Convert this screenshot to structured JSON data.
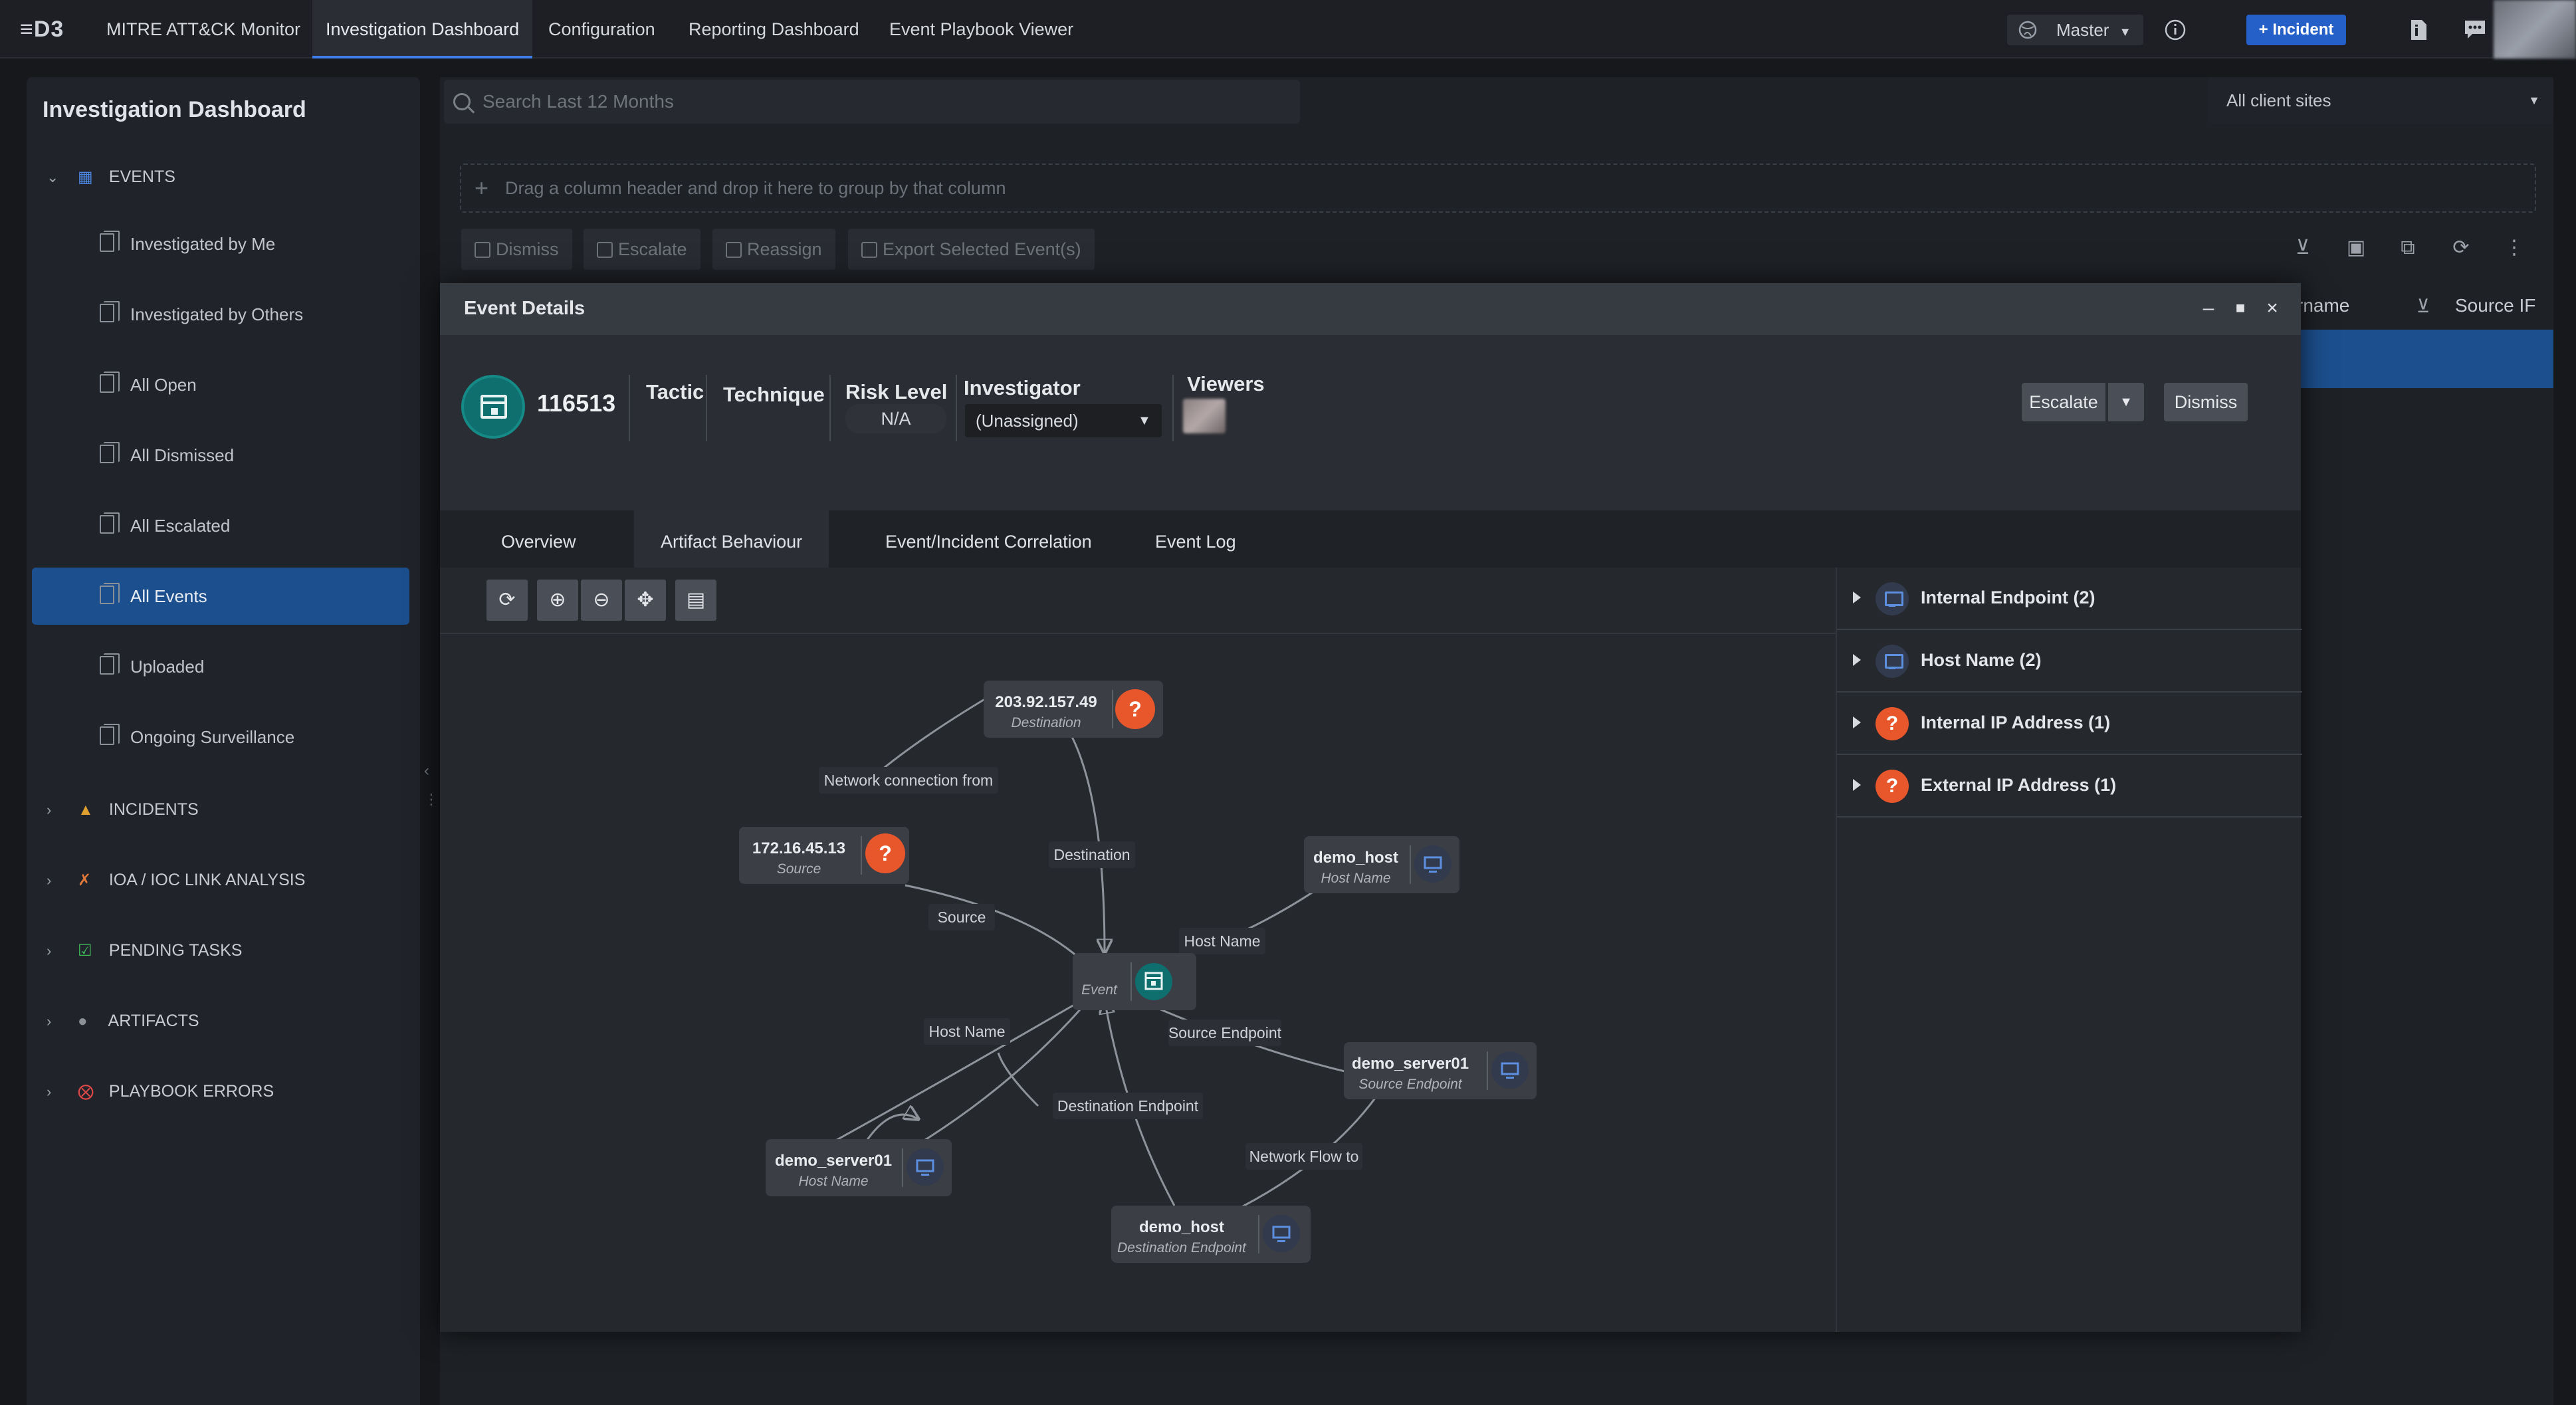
{
  "app": {
    "logo": "≡D3",
    "nav": [
      "MITRE ATT&CK Monitor",
      "Investigation Dashboard",
      "Configuration",
      "Reporting Dashboard",
      "Event Playbook Viewer"
    ],
    "master_label": "Master",
    "incident_label": "+ Incident"
  },
  "sidebar": {
    "title": "Investigation Dashboard",
    "events_group": "EVENTS",
    "items": [
      "Investigated by Me",
      "Investigated by Others",
      "All Open",
      "All Dismissed",
      "All Escalated",
      "All Events",
      "Uploaded",
      "Ongoing Surveillance"
    ],
    "groups": [
      "INCIDENTS",
      "IOA / IOC LINK ANALYSIS",
      "PENDING TASKS",
      "ARTIFACTS",
      "PLAYBOOK ERRORS"
    ]
  },
  "main": {
    "search_placeholder": "Search Last 12 Months",
    "sites": "All client sites",
    "drop_hint": "Drag a column header and drop it here to group by that column",
    "toolbar": [
      "Dismiss",
      "Escalate",
      "Reassign",
      "Export Selected Event(s)"
    ],
    "columns": [
      "rname",
      "Source IF"
    ]
  },
  "modal": {
    "title": "Event Details",
    "event_id": "116513",
    "labels": {
      "tactic": "Tactic",
      "technique": "Technique",
      "risk": "Risk Level",
      "investigator": "Investigator",
      "viewers": "Viewers"
    },
    "risk_value": "N/A",
    "investigator_value": "(Unassigned)",
    "escalate": "Escalate",
    "dismiss": "Dismiss",
    "tabs": [
      "Overview",
      "Artifact Behaviour",
      "Event/Incident Correlation",
      "Event Log"
    ],
    "active_tab": "Artifact Behaviour"
  },
  "graph": {
    "nodes": [
      {
        "id": "dest-ip",
        "title": "203.92.157.49",
        "subtitle": "Destination",
        "icon": "question-icon"
      },
      {
        "id": "src-ip",
        "title": "172.16.45.13",
        "subtitle": "Source",
        "icon": "question-icon"
      },
      {
        "id": "host1",
        "title": "demo_host",
        "subtitle": "Host Name",
        "icon": "monitor-icon"
      },
      {
        "id": "event",
        "title": "",
        "subtitle": "Event",
        "icon": "calendar-icon"
      },
      {
        "id": "srv-endpoint",
        "title": "demo_server01",
        "subtitle": "Source Endpoint",
        "icon": "monitor-icon"
      },
      {
        "id": "srv-host",
        "title": "demo_server01",
        "subtitle": "Host Name",
        "icon": "monitor-icon"
      },
      {
        "id": "dst-endpoint",
        "title": "demo_host",
        "subtitle": "Destination Endpoint",
        "icon": "monitor-icon"
      }
    ],
    "edge_labels": [
      "Network connection from",
      "Destination",
      "Source",
      "Host Name",
      "Source Endpoint",
      "Host Name",
      "Destination Endpoint",
      "Network Flow to"
    ]
  },
  "artifacts": [
    {
      "label": "Internal Endpoint (2)",
      "icon": "monitor-icon"
    },
    {
      "label": "Host Name (2)",
      "icon": "monitor-icon"
    },
    {
      "label": "Internal IP Address (1)",
      "icon": "question-icon"
    },
    {
      "label": "External IP Address (1)",
      "icon": "question-icon"
    }
  ],
  "colors": {
    "accent": "#3f7ee8",
    "selected": "#1c4f8e",
    "warning": "#e8572c",
    "teal": "#0f6e6e"
  }
}
